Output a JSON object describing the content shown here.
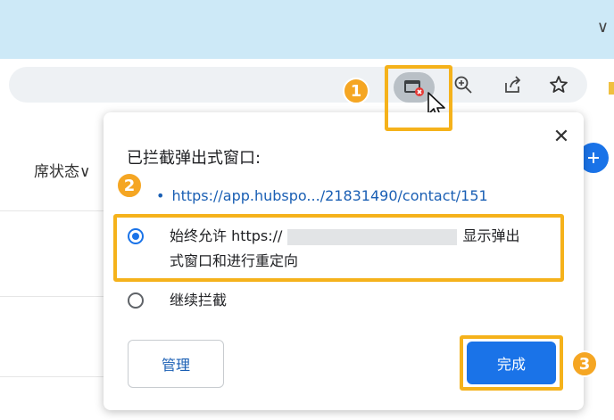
{
  "browser": {
    "titlebar_chevron": "∨",
    "toolbar_icons": [
      "blocked-popup-icon",
      "zoom-icon",
      "share-icon",
      "star-icon"
    ]
  },
  "page": {
    "column_header": "席状态∨"
  },
  "popup": {
    "title": "已拦截弹出式窗口:",
    "blocked_link": "https://app.hubspo.../21831490/contact/151",
    "option_allow": {
      "label_start": "始终允许 https://",
      "label_end": "显示弹出",
      "label_line2": "式窗口和进行重定向",
      "selected": true
    },
    "option_block": {
      "label": "继续拦截",
      "selected": false
    },
    "manage_label": "管理",
    "done_label": "完成"
  },
  "annotations": {
    "badge_1": "1",
    "badge_2": "2",
    "badge_3": "3",
    "highlight_color": "#f5b21b",
    "badge_color": "#f5a623"
  },
  "colors": {
    "accent": "#1a73e8",
    "titlebar": "#cde9f7",
    "link": "#1a5fb4"
  }
}
